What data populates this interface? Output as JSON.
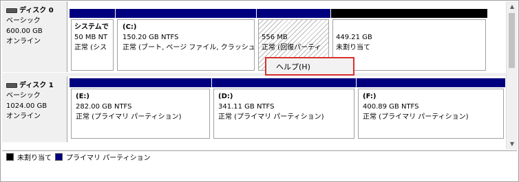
{
  "disks": [
    {
      "name": "ディスク 0",
      "type": "ベーシック",
      "size": "600.00 GB",
      "status": "オンライン"
    },
    {
      "name": "ディスク 1",
      "type": "ベーシック",
      "size": "1024.00 GB",
      "status": "オンライン"
    }
  ],
  "disk0_partitions": [
    {
      "title": "システムで",
      "size": "50 MB NT",
      "status": "正常 (シス"
    },
    {
      "title": "(C:)",
      "size": "150.20 GB NTFS",
      "status": "正常 (ブート, ページ ファイル, クラッシュ ダ"
    },
    {
      "size": "556 MB",
      "status": "正常 (回復パーティ"
    },
    {
      "size": "449.21 GB",
      "status": "未割り当て"
    }
  ],
  "disk1_partitions": [
    {
      "title": "(E:)",
      "size": "282.00 GB NTFS",
      "status": "正常 (プライマリ パーティション)"
    },
    {
      "title": "(D:)",
      "size": "341.11 GB NTFS",
      "status": "正常 (プライマリ パーティション)"
    },
    {
      "title": "(F:)",
      "size": "400.89 GB NTFS",
      "status": "正常 (プライマリ パーティション)"
    }
  ],
  "legend": [
    {
      "label": "未割り当て",
      "color": "#000000"
    },
    {
      "label": "プライマリ パーティション",
      "color": "#00007f"
    }
  ],
  "context_menu": {
    "item": "ヘルプ(H)"
  },
  "icons": {
    "disk": "hard-disk-icon",
    "scroll_up": "scroll-up-arrow-icon",
    "scroll_down": "scroll-down-arrow-icon"
  }
}
